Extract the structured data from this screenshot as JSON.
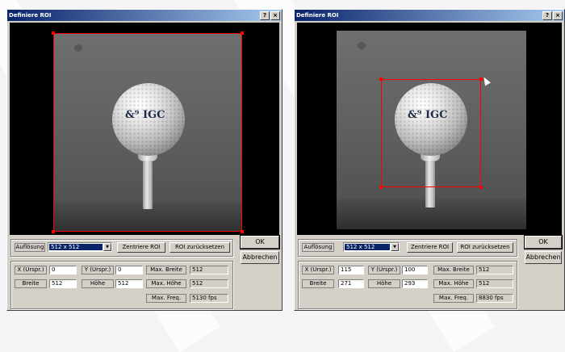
{
  "colors": {
    "titlebar": "#0a246a",
    "roi": "#ff0000",
    "face": "#d4d0c8"
  },
  "dialogs": [
    {
      "title": "Definiere ROI",
      "help": "?",
      "close": "×",
      "ball_logo": "&⁹ IGC",
      "resolution_label": "Auflösung",
      "resolution_value": "512 x 512",
      "center_button": "Zentriere ROI",
      "reset_button": "ROI zurücksetzen",
      "ok_button": "OK",
      "cancel_button": "Abbrechen",
      "x_label": "X (Urspr.)",
      "x_value": "0",
      "y_label": "Y (Urspr.)",
      "y_value": "0",
      "width_label": "Breite",
      "width_value": "512",
      "height_label": "Höhe",
      "height_value": "512",
      "max_width_label": "Max. Breite",
      "max_width_value": "512",
      "max_height_label": "Max. Höhe",
      "max_height_value": "512",
      "max_freq_label": "Max. Freq.",
      "max_freq_value": "5130 fps"
    },
    {
      "title": "Definiere ROI",
      "help": "?",
      "close": "×",
      "ball_logo": "&⁹ IGC",
      "resolution_label": "Auflösung",
      "resolution_value": "512 x 512",
      "center_button": "Zentriere ROI",
      "reset_button": "ROI zurücksetzen",
      "ok_button": "OK",
      "cancel_button": "Abbrechen",
      "x_label": "X (Urspr.)",
      "x_value": "115",
      "y_label": "Y (Urspr.)",
      "y_value": "100",
      "width_label": "Breite",
      "width_value": "271",
      "height_label": "Höhe",
      "height_value": "293",
      "max_width_label": "Max. Breite",
      "max_width_value": "512",
      "max_height_label": "Max. Höhe",
      "max_height_value": "512",
      "max_freq_label": "Max. Freq.",
      "max_freq_value": "8830 fps"
    }
  ]
}
